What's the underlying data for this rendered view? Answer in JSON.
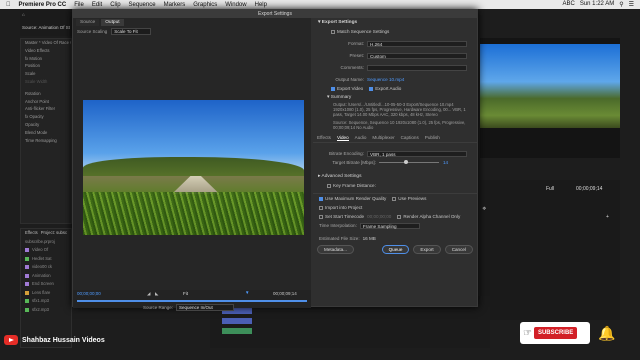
{
  "menubar": {
    "app": "Premiere Pro CC",
    "items": [
      "File",
      "Edit",
      "Clip",
      "Sequence",
      "Markers",
      "Graphics",
      "Window",
      "Help"
    ],
    "status": [
      "ABC",
      "Sun 1:22 AM"
    ]
  },
  "left_panel": {
    "source_label": "Source: Animation Of Steel",
    "master_label": "Master * Video Of Race Cu",
    "items": [
      "Video Effects",
      "fx Motion",
      "Position",
      "Scale",
      "Scale Width",
      "Rotation",
      "Anchor Point",
      "Anti-flicker Filter",
      "fx Opacity",
      "Opacity",
      "Blend Mode",
      "Time Remapping"
    ]
  },
  "project": {
    "tabs": [
      "Effects",
      "Project: subsc"
    ],
    "file": "subscribe.prproj",
    "rows": [
      {
        "name": "Video Of",
        "color": "#a07ad6"
      },
      {
        "name": "Hedlet Sat",
        "color": "#58b858"
      },
      {
        "name": "video00 ck",
        "color": "#a07ad6"
      },
      {
        "name": "Animation",
        "color": "#a07ad6"
      },
      {
        "name": "End Screen",
        "color": "#a07ad6"
      },
      {
        "name": "Lens flare",
        "color": "#d6a03a"
      },
      {
        "name": "sfx1.mp3",
        "color": "#58b858"
      },
      {
        "name": "sfx2.mp3",
        "color": "#58b858"
      }
    ]
  },
  "dialog": {
    "title": "Export Settings",
    "tabs": [
      "Source",
      "Output"
    ],
    "active_tab": "Output",
    "source_scaling_label": "Source Scaling",
    "source_scaling_value": "Scale To Fit",
    "timecode_in": "00;00;00;00",
    "timecode_out": "00;00;09;14",
    "fit_value": "Fit",
    "source_range_label": "Source Range:",
    "source_range_value": "Sequence In/Out",
    "export_settings_header": "Export Settings",
    "match_sequence_label": "Match Sequence Settings",
    "format_label": "Format:",
    "format_value": "H.264",
    "preset_label": "Preset:",
    "preset_value": "Custom",
    "comments_label": "Comments:",
    "output_name_label": "Output Name:",
    "output_name_value": "Sequence 10.mp4",
    "export_video_label": "Export Video",
    "export_audio_label": "Export Audio",
    "summary_header": "Summary",
    "summary_output": "Output: /Users/.../Untitled/...10-05-50-3 Export/Sequence 10.mp4 1920x1080 (1.0), 25 fps, Progressive, Hardware Encoding, 00... VBR, 1 pass, Target 14.00 Mbps AAC, 320 kbps, 48 kHz, Stereo",
    "summary_source": "Source: Sequence, Sequence 10 1920x1080 (1.0), 25 fps, Progressive, 00;00;09;14 No Audio",
    "sub_tabs": [
      "Effects",
      "Video",
      "Audio",
      "Multiplexer",
      "Captions",
      "Publish"
    ],
    "active_sub_tab": "Video",
    "bitrate_encoding_label": "Bitrate Encoding:",
    "bitrate_encoding_value": "VBR, 1 pass",
    "target_bitrate_label": "Target Bitrate [Mbps]:",
    "target_bitrate_value": "14",
    "target_bitrate_fraction": 0.45,
    "advanced_settings_header": "Advanced Settings",
    "key_frame_label": "Key Frame Distance:",
    "use_max_render_label": "Use Maximum Render Quality",
    "use_previews_label": "Use Previews",
    "import_into_project_label": "Import into Project",
    "set_start_timecode_label": "Set Start Timecode",
    "start_timecode_value": "00;00;00;00",
    "render_alpha_label": "Render Alpha Channel Only",
    "time_interpolation_label": "Time Interpolation:",
    "time_interpolation_value": "Frame Sampling",
    "estimated_size_label": "Estimated File Size:",
    "estimated_size_value": "16 MB",
    "buttons": {
      "metadata": "Metadata...",
      "queue": "Queue",
      "export": "Export",
      "cancel": "Cancel"
    }
  },
  "right_monitor": {
    "full_label": "Full",
    "timecode": "00;00;09;14"
  },
  "overlay": {
    "channel_name": "Shahbaz Hussain Videos",
    "subscribe_label": "SUBSCRIBE"
  }
}
